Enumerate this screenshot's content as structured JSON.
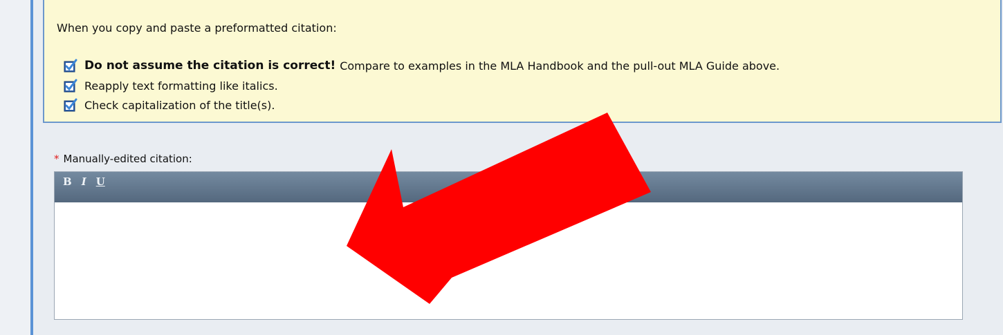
{
  "notice": {
    "intro": "When you copy and paste a preformatted citation:",
    "items": [
      {
        "emphasis": "Do not assume the citation is correct!",
        "text": "Compare to examples in the MLA Handbook and the pull-out MLA Guide above."
      },
      {
        "emphasis": "",
        "text": "Reapply text formatting like italics."
      },
      {
        "emphasis": "",
        "text": "Check capitalization of the title(s)."
      }
    ],
    "icon": "checked-checkbox-icon",
    "background": "#fcf9d3",
    "border_color": "#6b97cc"
  },
  "citation_field": {
    "required_mark": "*",
    "label": "Manually-edited citation:",
    "value": "",
    "toolbar": {
      "bold": "B",
      "italic": "I",
      "underline": "U"
    }
  },
  "annotation": {
    "icon": "red-arrow-icon",
    "color": "#ff0000"
  }
}
